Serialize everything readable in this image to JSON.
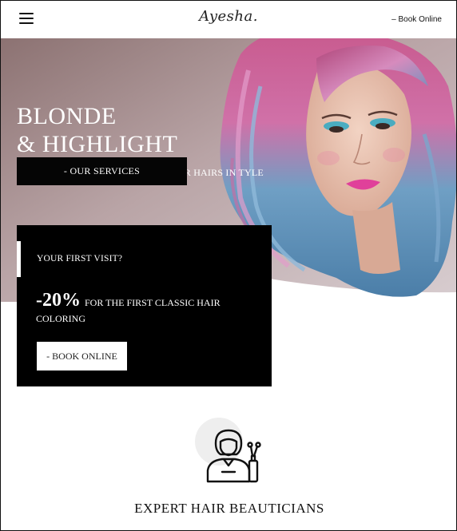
{
  "header": {
    "logo": "Ayesha.",
    "book_link": "– Book Online"
  },
  "hero": {
    "title_line1": "BLONDE",
    "title_line2": "& HIGHLIGHT",
    "subtitle": "DIVIDE YOUR UNIQUENESS BY YOUR HAIRS IN TYLE",
    "services_button": "- OUR SERVICES"
  },
  "promo": {
    "heading": "YOUR FIRST VISIT?",
    "discount": "-20%",
    "offer_text": "FOR THE FIRST CLASSIC HAIR COLORING",
    "book_button": "- BOOK ONLINE"
  },
  "features": {
    "icon": "hairdresser-icon",
    "title": "EXPERT HAIR BEAUTICIANS"
  }
}
